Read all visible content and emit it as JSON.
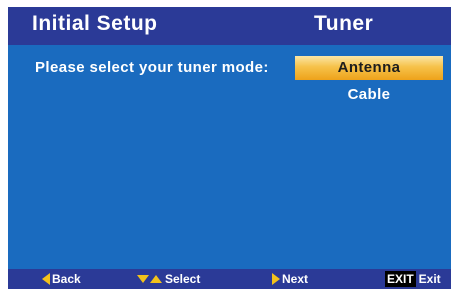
{
  "header": {
    "title": "Initial Setup",
    "section": "Tuner"
  },
  "prompt": "Please select your tuner mode:",
  "options": [
    {
      "label": "Antenna",
      "selected": true
    },
    {
      "label": "Cable",
      "selected": false
    }
  ],
  "footer": {
    "back_label": "Back",
    "select_label": "Select",
    "next_label": "Next",
    "exit_key": "EXIT",
    "exit_label": "Exit"
  },
  "icons": {
    "back": "left-arrow-icon",
    "select": "up-down-arrows-icon",
    "next": "right-arrow-icon"
  },
  "colors": {
    "background": "#1a6bbf",
    "bars": "#2b3a97",
    "highlight": "#f6c24a",
    "arrow": "#f2c21b"
  }
}
